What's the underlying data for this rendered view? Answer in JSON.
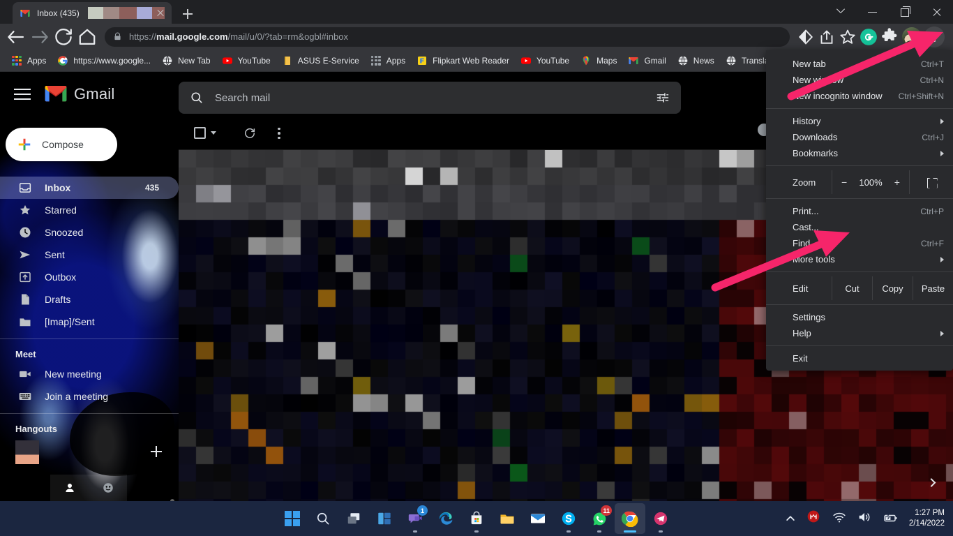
{
  "browser": {
    "tab": {
      "title": "Inbox (435)",
      "favicon": "gmail-icon",
      "redacted": true
    },
    "new_tab_label": "+",
    "window_controls": [
      "tab-search-chevron",
      "minimize",
      "maximize",
      "close"
    ],
    "omnibox": {
      "url_prefix": "https://",
      "url_domain": "mail.google.com",
      "url_path": "/mail/u/0/?tab=rm&ogbl#inbox",
      "lock": "secure-lock-icon"
    },
    "toolbar_icons": [
      "incognito-diamond-icon",
      "share-icon",
      "bookmark-star-icon",
      "grammarly-icon",
      "extensions-puzzle-icon",
      "profile-avatar",
      "chrome-menu-kebab"
    ],
    "bookmarks": [
      {
        "label": "Apps",
        "icon": "apps-grid-icon"
      },
      {
        "label": "https://www.google...",
        "icon": "google-icon"
      },
      {
        "label": "New Tab",
        "icon": "globe-icon"
      },
      {
        "label": "YouTube",
        "icon": "youtube-icon"
      },
      {
        "label": "ASUS E-Service",
        "icon": "folder-icon"
      },
      {
        "label": "Apps",
        "icon": "apps-grid-gray-icon"
      },
      {
        "label": "Flipkart Web Reader",
        "icon": "flipkart-icon"
      },
      {
        "label": "YouTube",
        "icon": "youtube-icon"
      },
      {
        "label": "Maps",
        "icon": "maps-pin-icon"
      },
      {
        "label": "Gmail",
        "icon": "gmail-icon"
      },
      {
        "label": "News",
        "icon": "globe-icon"
      },
      {
        "label": "Transla",
        "icon": "globe-icon"
      }
    ]
  },
  "chrome_menu": {
    "groups": [
      {
        "items": [
          {
            "label": "New tab",
            "shortcut": "Ctrl+T",
            "submenu": false
          },
          {
            "label": "New window",
            "shortcut": "Ctrl+N",
            "submenu": false
          },
          {
            "label": "New incognito window",
            "shortcut": "Ctrl+Shift+N",
            "submenu": false
          }
        ]
      },
      {
        "items": [
          {
            "label": "History",
            "shortcut": "",
            "submenu": true
          },
          {
            "label": "Downloads",
            "shortcut": "Ctrl+J",
            "submenu": false
          },
          {
            "label": "Bookmarks",
            "shortcut": "",
            "submenu": true
          }
        ]
      },
      {
        "zoom": {
          "label": "Zoom",
          "minus": "−",
          "value": "100%",
          "plus": "+",
          "fullscreen_icon": "fullscreen-icon"
        }
      },
      {
        "items": [
          {
            "label": "Print...",
            "shortcut": "Ctrl+P",
            "submenu": false
          },
          {
            "label": "Cast...",
            "shortcut": "",
            "submenu": false
          },
          {
            "label": "Find...",
            "shortcut": "Ctrl+F",
            "submenu": false
          },
          {
            "label": "More tools",
            "shortcut": "",
            "submenu": true
          }
        ]
      },
      {
        "edit": {
          "label": "Edit",
          "cut": "Cut",
          "copy": "Copy",
          "paste": "Paste"
        }
      },
      {
        "items": [
          {
            "label": "Settings",
            "shortcut": "",
            "submenu": false
          },
          {
            "label": "Help",
            "shortcut": "",
            "submenu": true
          }
        ]
      },
      {
        "items": [
          {
            "label": "Exit",
            "shortcut": "",
            "submenu": false
          }
        ]
      }
    ]
  },
  "gmail": {
    "logo_text": "Gmail",
    "search": {
      "placeholder": "Search mail",
      "icon": "search-icon",
      "options_icon": "search-options-icon"
    },
    "compose": {
      "label": "Compose",
      "icon": "compose-plus-icon"
    },
    "nav": [
      {
        "label": "Inbox",
        "count": "435",
        "icon": "inbox-icon",
        "active": true
      },
      {
        "label": "Starred",
        "count": "",
        "icon": "star-icon",
        "active": false
      },
      {
        "label": "Snoozed",
        "count": "",
        "icon": "clock-icon",
        "active": false
      },
      {
        "label": "Sent",
        "count": "",
        "icon": "send-icon",
        "active": false
      },
      {
        "label": "Outbox",
        "count": "",
        "icon": "outbox-icon",
        "active": false
      },
      {
        "label": "Drafts",
        "count": "",
        "icon": "draft-icon",
        "active": false
      },
      {
        "label": "[Imap]/Sent",
        "count": "",
        "icon": "label-icon",
        "active": false
      }
    ],
    "meet": {
      "title": "Meet",
      "items": [
        {
          "label": "New meeting",
          "icon": "video-camera-icon"
        },
        {
          "label": "Join a meeting",
          "icon": "keyboard-icon"
        }
      ]
    },
    "hangouts": {
      "title": "Hangouts",
      "add_icon": "plus-icon",
      "avatar": "contact-avatar"
    },
    "toolbar": {
      "select_all": "select-all-checkbox",
      "refresh": "refresh-icon",
      "more": "more-kebab-icon"
    },
    "content_redacted": true,
    "content_chevron": "chevron-right-icon"
  },
  "taskbar": {
    "apps": [
      {
        "name": "start-button",
        "badge": ""
      },
      {
        "name": "search-button",
        "badge": ""
      },
      {
        "name": "task-view-button",
        "badge": ""
      },
      {
        "name": "widgets-button",
        "badge": ""
      },
      {
        "name": "teams-chat-button",
        "badge": "1"
      },
      {
        "name": "edge-button",
        "badge": ""
      },
      {
        "name": "microsoft-store-button",
        "badge": ""
      },
      {
        "name": "file-explorer-button",
        "badge": ""
      },
      {
        "name": "mail-button",
        "badge": ""
      },
      {
        "name": "skype-button",
        "badge": ""
      },
      {
        "name": "whatsapp-button",
        "badge": "11"
      },
      {
        "name": "chrome-button",
        "badge": ""
      },
      {
        "name": "telegram-button",
        "badge": ""
      }
    ],
    "tray": {
      "overflow": "show-hidden-icons-chevron",
      "mcafee": "mcafee-icon",
      "wifi": "wifi-icon",
      "volume": "volume-icon",
      "battery": "battery-charging-icon",
      "time": "1:27 PM",
      "date": "2/14/2022"
    }
  },
  "annotations": {
    "arrow_top": {
      "label": "arrow pointing to chrome menu button",
      "color": "#f6256a"
    },
    "arrow_bottom": {
      "label": "arrow pointing to More tools",
      "color": "#f6256a"
    }
  }
}
